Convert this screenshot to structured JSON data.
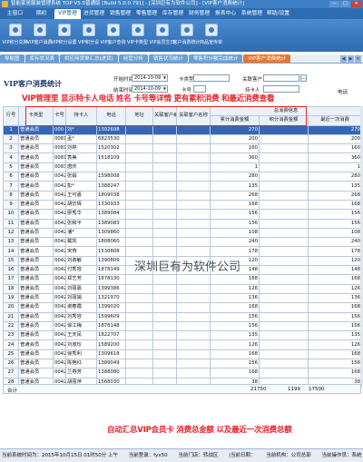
{
  "window": {
    "title": "智能家居服装管理系统 TOP V5.0普通版 [Build 5.0.0.791] - [深圳巨有为软件公司] - [VIP客户消费统计]",
    "controls": [
      "—",
      "□",
      "✕"
    ]
  },
  "menu": [
    "主窗口",
    "期初",
    "VIP管理",
    "进货管理",
    "销售管理",
    "零售管理",
    "库存管理",
    "财务管理",
    "报表中心",
    "系统管理",
    "帮助/设置"
  ],
  "menu_active": 2,
  "toolbar": [
    {
      "label": "VIP积分兑换",
      "icon": "gift-icon"
    },
    {
      "label": "VIP客户消费",
      "icon": "receipt-icon"
    },
    {
      "label": "VIP积分设置",
      "icon": "settings-icon"
    },
    {
      "label": "VIP积分设",
      "icon": "gear-icon"
    },
    {
      "label": "VIP客户查询",
      "icon": "search-icon"
    },
    {
      "label": "VIP卡类型",
      "icon": "card-icon"
    },
    {
      "label": "VIP会员生日",
      "icon": "cake-icon"
    },
    {
      "label": "客户消费统计",
      "icon": "chart-icon"
    },
    {
      "label": "商品宣传单",
      "icon": "document-icon"
    }
  ],
  "tabs": [
    "导航图",
    "库存状况表",
    "供应商货单汇总(进货)",
    "经营分析",
    "销售状况统计",
    "零售积分额完成统计",
    "VIP客户消费统计"
  ],
  "tabs_active": 6,
  "page_title": "VIP客户消费统计",
  "filters": {
    "start_date_label": "开始时间",
    "start_date": "2014-10-09",
    "end_date_label": "结束时间",
    "end_date": "2014-10-09",
    "card_type_label": "卡类型",
    "card_no_label": "卡号",
    "related_customer_label": "关联客户",
    "holder_label": "持卡人",
    "phone_label": "电话"
  },
  "annotation_top": "VIP管理里 显示特卡人电话 姓名 卡号等详情 更有累积消费 和最近消费查看",
  "annotation_bottom": "自动汇总VIP会员卡 消费总金额 以及最近一次消费总额",
  "watermark": "深圳巨有为软件公司",
  "table": {
    "headers": [
      "行号",
      "卡类型",
      "卡号",
      "持卡人",
      "电话",
      "地址",
      "关联客户编号",
      "关联客户名称"
    ],
    "group_header": "总消费信息",
    "sub_headers": [
      "累计消费金额",
      "积分消费金额",
      "最近一次消费"
    ],
    "rows": [
      [
        "1",
        "普通会员",
        "000",
        "刘*",
        "1302698",
        "",
        "",
        "",
        "270",
        "",
        "270"
      ],
      [
        "2",
        "普通会员",
        "00810",
        "孟*",
        "6823530",
        "",
        "",
        "",
        "200",
        "",
        "200"
      ],
      [
        "3",
        "普通会员",
        "00811",
        "刘婷",
        "1520302",
        "",
        "",
        "",
        "160",
        "",
        "160"
      ],
      [
        "4",
        "普通会员",
        "00813",
        "袁美",
        "1518109",
        "",
        "",
        "",
        "360",
        "",
        "360"
      ],
      [
        "5",
        "普通会员",
        "00830",
        "唐庆",
        "",
        "",
        "",
        "",
        "1",
        "",
        "1"
      ],
      [
        "6",
        "普通会员",
        "00420",
        "张娟",
        "1598008",
        "",
        "",
        "",
        "280",
        "",
        "280"
      ],
      [
        "7",
        "普通会员",
        "00421",
        "彭*",
        "1388247",
        "",
        "",
        "",
        "135",
        "",
        "135"
      ],
      [
        "8",
        "普通会员",
        "00421",
        "王可嘉",
        "1809038",
        "",
        "",
        "",
        "268",
        "",
        "268"
      ],
      [
        "9",
        "普通会员",
        "00421",
        "胡仿辉",
        "1330933",
        "",
        "",
        "",
        "168",
        "",
        "168"
      ],
      [
        "10",
        "普通会员",
        "00421",
        "廖秀华",
        "1389084",
        "",
        "",
        "",
        "156",
        "",
        "156"
      ],
      [
        "11",
        "普通会员",
        "00421",
        "张和平",
        "1389083",
        "",
        "",
        "",
        "156",
        "",
        "156"
      ],
      [
        "12",
        "普通会员",
        "00421",
        "潘*",
        "1309860",
        "",
        "",
        "",
        "108",
        "",
        "108"
      ],
      [
        "13",
        "普通会员",
        "00425",
        "戴凯",
        "1808060",
        "",
        "",
        "",
        "240",
        "",
        "240"
      ],
      [
        "14",
        "普通会员",
        "00425",
        "宋燕",
        "1530808",
        "",
        "",
        "",
        "178",
        "",
        "178"
      ],
      [
        "15",
        "普通会员",
        "00425",
        "刘淑敏",
        "1390809",
        "",
        "",
        "",
        "120",
        "",
        "120"
      ],
      [
        "16",
        "普通会员",
        "00425",
        "付秀容",
        "1878149",
        "",
        "",
        "",
        "148",
        "",
        "148"
      ],
      [
        "17",
        "普通会员",
        "00425",
        "郑艺芳",
        "1878130",
        "",
        "",
        "",
        "168",
        "",
        "168"
      ],
      [
        "18",
        "普通会员",
        "00425",
        "刘丽嘉",
        "1399386",
        "",
        "",
        "",
        "126",
        "",
        "126"
      ],
      [
        "19",
        "普通会员",
        "00425",
        "刘丽娟",
        "1321970",
        "",
        "",
        "",
        "136",
        "",
        "136"
      ],
      [
        "20",
        "普通会员",
        "00425",
        "谢春霞",
        "1399020",
        "",
        "",
        "",
        "168",
        "",
        "168"
      ],
      [
        "21",
        "普通会员",
        "00425",
        "刘秀容",
        "1599609",
        "",
        "",
        "",
        "156",
        "",
        "156"
      ],
      [
        "22",
        "普通会员",
        "00426",
        "徐江梅",
        "1878148",
        "",
        "",
        "",
        "156",
        "",
        "156"
      ],
      [
        "23",
        "普通会员",
        "00426",
        "王天凤",
        "1822707",
        "",
        "",
        "",
        "135",
        "",
        "135"
      ],
      [
        "24",
        "普通会员",
        "00426",
        "刘淑珍",
        "1589200",
        "",
        "",
        "",
        "126",
        "",
        "126"
      ],
      [
        "25",
        "普通会员",
        "00426",
        "徐秀利",
        "1309618",
        "",
        "",
        "",
        "168",
        "",
        "168"
      ],
      [
        "26",
        "普通会员",
        "00426",
        "陈艳红",
        "1389049",
        "",
        "",
        "",
        "156",
        "",
        "156"
      ],
      [
        "27",
        "普通会员",
        "00426",
        "兰燕芳",
        "1388080",
        "",
        "",
        "",
        "168",
        "",
        "168"
      ],
      [
        "28",
        "普通会员",
        "00426",
        "胡丽萍",
        "1568030",
        "",
        "",
        "",
        "38",
        "",
        "38"
      ]
    ],
    "total_label": "合计",
    "totals": [
      "21750",
      "1199",
      "17500"
    ]
  },
  "statusbar": {
    "login_time": "当前系统时间为：2015年10月15日 01时50分 上午",
    "user": "当前登录：fyx50",
    "dept": "当前门店：转战区",
    "date": "|当前日期：",
    "org": "当前机构：公司总部",
    "op": "当前操作员：系统"
  }
}
